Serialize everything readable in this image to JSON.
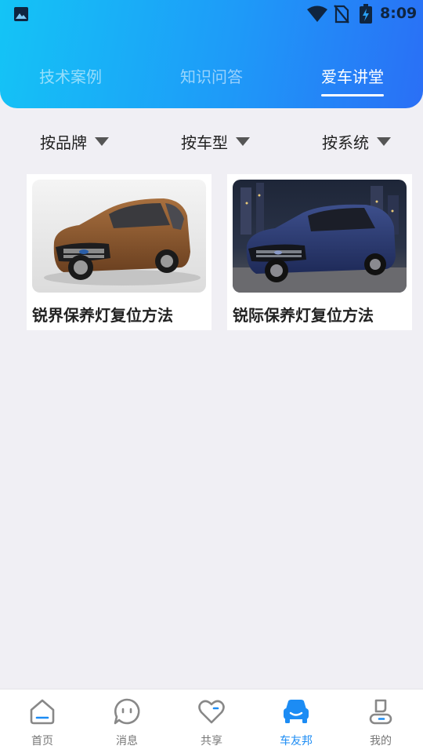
{
  "status_bar": {
    "time": "8:09",
    "icons": [
      "gallery-icon",
      "wifi-icon",
      "no-sim-icon",
      "battery-charging-icon"
    ]
  },
  "tabs": [
    {
      "label": "技术案例",
      "active": false
    },
    {
      "label": "知识问答",
      "active": false
    },
    {
      "label": "爱车讲堂",
      "active": true
    }
  ],
  "filters": [
    {
      "label": "按品牌",
      "icon": "caret-down-icon"
    },
    {
      "label": "按车型",
      "icon": "caret-down-icon"
    },
    {
      "label": "按系统",
      "icon": "caret-down-icon"
    }
  ],
  "cards": [
    {
      "title": "锐界保养灯复位方法",
      "image": "bronze-suv-photo"
    },
    {
      "title": "锐际保养灯复位方法",
      "image": "blue-suv-photo"
    }
  ],
  "bottom_nav": [
    {
      "label": "首页",
      "icon": "home-icon",
      "active": false
    },
    {
      "label": "消息",
      "icon": "message-icon",
      "active": false
    },
    {
      "label": "共享",
      "icon": "heart-icon",
      "active": false
    },
    {
      "label": "车友邦",
      "icon": "car-icon",
      "active": true
    },
    {
      "label": "我的",
      "icon": "profile-icon",
      "active": false
    }
  ],
  "colors": {
    "header_gradient_start": "#14c4f6",
    "header_gradient_end": "#2a6ff6",
    "accent": "#1c8cf4",
    "background": "#f0eff4"
  }
}
